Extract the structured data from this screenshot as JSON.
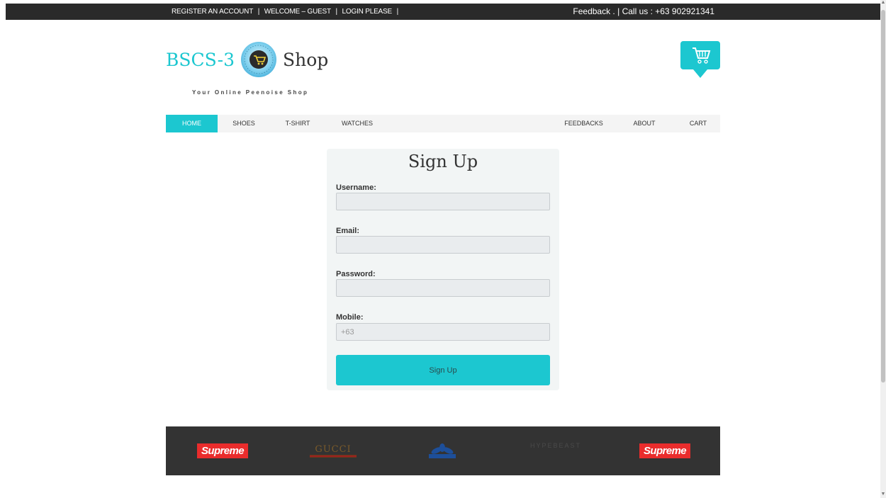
{
  "topbar": {
    "register": "REGISTER AN ACCOUNT",
    "welcome": "WELCOME – GUEST",
    "login": "LOGIN PLEASE",
    "feedback": "Feedback .",
    "call": "Call us : +63 902921341"
  },
  "logo": {
    "left": "BSCS-3",
    "right": "Shop",
    "tagline": "Your Online Peenoise Shop"
  },
  "nav": {
    "home": "HOME",
    "shoes": "SHOES",
    "tshirt": "T-SHIRT",
    "watches": "WATCHES",
    "feedbacks": "FEEDBACKS",
    "about": "ABOUT",
    "cart": "CART"
  },
  "form": {
    "title": "Sign Up",
    "username_label": "Username:",
    "email_label": "Email:",
    "password_label": "Password:",
    "mobile_label": "Mobile:",
    "mobile_placeholder": "+63",
    "submit_label": "Sign Up"
  },
  "brands": {
    "supreme1": "Supreme",
    "gucci": "GUCCI",
    "hypebeast": "HYPEBEAST",
    "supreme2": "Supreme"
  },
  "colors": {
    "accent": "#1cc7d0",
    "topbar": "#2a2a2a",
    "footer": "#333333"
  }
}
